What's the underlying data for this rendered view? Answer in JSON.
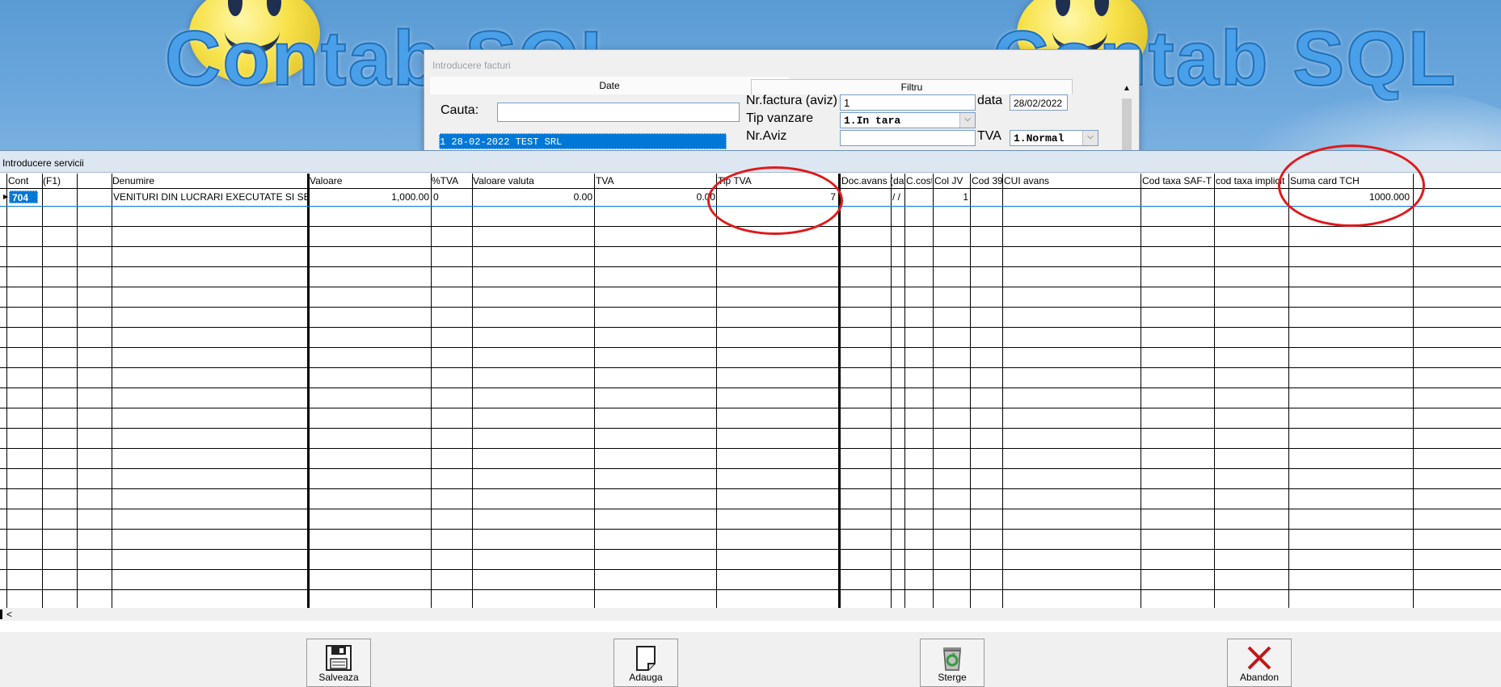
{
  "banner": {
    "logo_left": "Contab SQL",
    "logo_right": "Contab SQL"
  },
  "dialog": {
    "title": "Introducere facturi",
    "tab_date": "Date",
    "tab_filtru": "Filtru",
    "cauta_label": "Cauta:",
    "cauta_value": "",
    "list_selected": "1                  28-02-2022 TEST SRL",
    "nr_factura_label": "Nr.factura (aviz)",
    "nr_factura_value": "1",
    "data_label": "data",
    "data_value": "28/02/2022",
    "tip_vanzare_label": "Tip vanzare",
    "tip_vanzare_value": "1.In tara",
    "nr_aviz_label": "Nr.Aviz",
    "nr_aviz_value": "",
    "tva_label": "TVA",
    "tva_value": "1.Normal"
  },
  "grid": {
    "title": "Introducere servicii",
    "columns": [
      "Cont",
      "(F1)",
      "",
      "Denumire",
      "Valoare",
      "%TVA",
      "Valoare valuta",
      "TVA",
      "Tip TVA",
      "Doc.avans (data)",
      "C.cost",
      "Col JV",
      "Cod 39",
      "CUI avans",
      "Cod taxa SAF-T",
      "cod taxa implicit",
      "Suma card TCH"
    ],
    "rows": [
      {
        "cont": "704",
        "f1": "",
        "extra": "",
        "denumire": "VENITURI DIN LUCRARI EXECUTATE SI SERVICII PRESTATE",
        "valoare": "1,000.00",
        "pct_tva": "0",
        "valoare_valuta": "0.00",
        "tva": "0.00",
        "tip_tva": "7",
        "doc_avans": "/ /",
        "c_cost": "",
        "col_jv": "1",
        "cod39": "",
        "cui_avans": "",
        "cod_saft": "",
        "cod_implicit": "",
        "suma_tch": "1000.000"
      }
    ],
    "scroll_arrow": "<"
  },
  "buttons": {
    "save": "Salveaza",
    "add": "Adauga",
    "delete": "Sterge",
    "cancel": "Abandon"
  },
  "colors": {
    "selection": "#0078d7",
    "annotation_circle": "#e0191b",
    "banner": "#5a9bd4"
  }
}
